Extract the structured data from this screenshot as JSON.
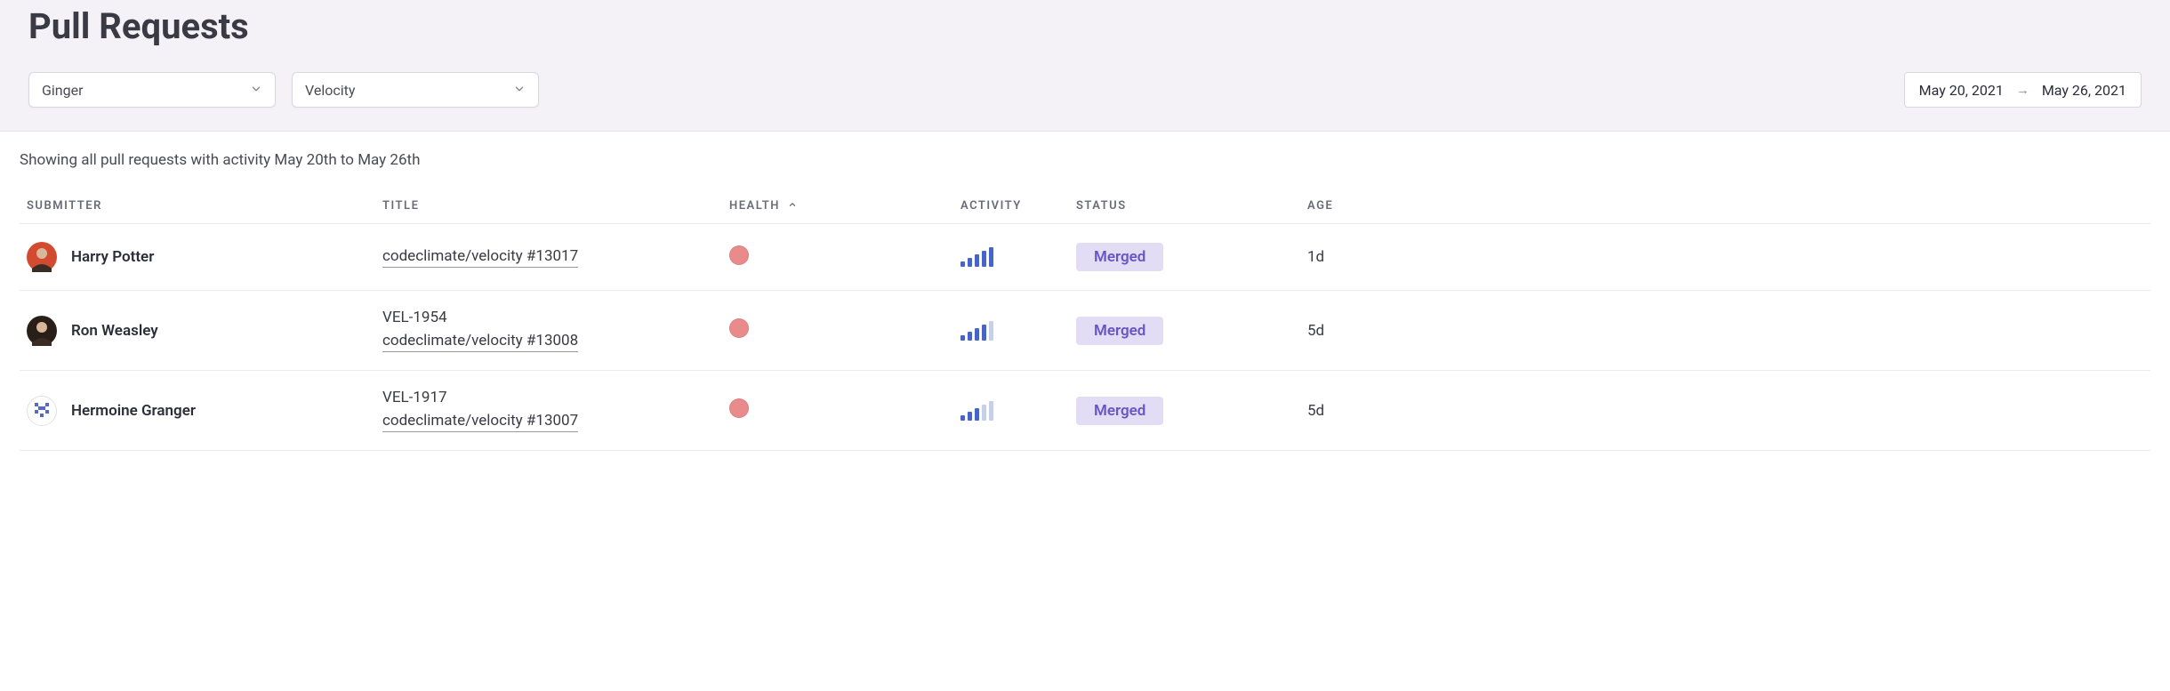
{
  "header": {
    "title": "Pull Requests"
  },
  "filters": {
    "org_select": "Ginger",
    "repo_select": "Velocity"
  },
  "date_range": {
    "start": "May 20, 2021",
    "end": "May 26, 2021"
  },
  "summary": "Showing all pull requests with activity May 20th to May 26th",
  "columns": {
    "submitter": "SUBMITTER",
    "title": "TITLE",
    "health": "HEALTH",
    "activity": "ACTIVITY",
    "status": "STATUS",
    "age": "AGE"
  },
  "sort": {
    "column": "health",
    "direction": "asc"
  },
  "colors": {
    "health_dot": "#e98b8b",
    "activity_active": "#4a63c8",
    "activity_inactive": "#c8cfe9",
    "status_merged_bg": "#e2dcf5",
    "status_merged_fg": "#6a55c4"
  },
  "activity_bar_heights": [
    6,
    10,
    14,
    18,
    22
  ],
  "rows": [
    {
      "submitter": "Harry Potter",
      "avatar": {
        "type": "photo",
        "bg": "#d24a2f",
        "ring": "#d24a2f"
      },
      "title_top": null,
      "title_link": "codeclimate/velocity #13017",
      "health": "red",
      "activity_level": 5,
      "status": "Merged",
      "age": "1d"
    },
    {
      "submitter": "Ron Weasley",
      "avatar": {
        "type": "photo",
        "bg": "#2a1f18",
        "ring": "#2a1f18"
      },
      "title_top": "VEL-1954",
      "title_link": "codeclimate/velocity #13008",
      "health": "red",
      "activity_level": 4,
      "status": "Merged",
      "age": "5d"
    },
    {
      "submitter": "Hermoine Granger",
      "avatar": {
        "type": "identicon",
        "bg": "#ffffff",
        "ring": "#e0e0e8"
      },
      "title_top": "VEL-1917",
      "title_link": "codeclimate/velocity #13007",
      "health": "red",
      "activity_level": 3,
      "status": "Merged",
      "age": "5d"
    }
  ]
}
